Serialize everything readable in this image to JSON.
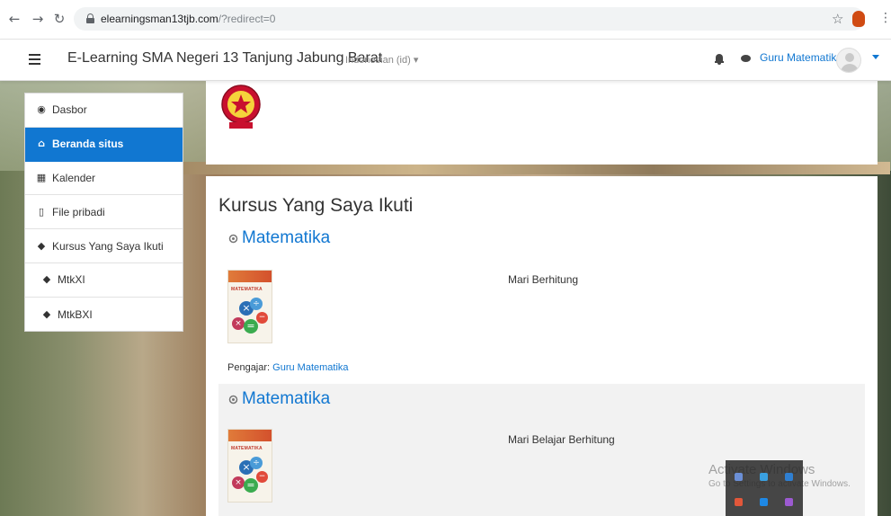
{
  "browser": {
    "back_icon": "arrow-left",
    "forward_icon": "arrow-right",
    "reload_icon": "reload",
    "url_host": "elearningsman13tjb.com",
    "url_path": "/?redirect=0"
  },
  "navbar": {
    "site_name": "E-Learning SMA Negeri 13 Tanjung Jabung Barat",
    "language": "Indonesian (id) ▾",
    "user_name": "Guru Matematika"
  },
  "drawer": {
    "items": [
      {
        "label": "Dasbor",
        "icon": "dashboard-icon"
      },
      {
        "label": "Beranda situs",
        "icon": "home-icon"
      },
      {
        "label": "Kalender",
        "icon": "calendar-icon"
      },
      {
        "label": "File pribadi",
        "icon": "file-icon"
      },
      {
        "label": "Kursus Yang Saya Ikuti",
        "icon": "graduation-cap-icon"
      },
      {
        "label": "MtkXI",
        "icon": "graduation-cap-icon"
      },
      {
        "label": "MtkBXI",
        "icon": "graduation-cap-icon"
      }
    ]
  },
  "main": {
    "title": "Kursus Yang Saya Ikuti",
    "courses": [
      {
        "name": "Matematika",
        "summary": "Mari Berhitung",
        "image_label": "MATEMATIKA",
        "teacher_label": "Pengajar:",
        "teacher_name": "Guru Matematika"
      },
      {
        "name": "Matematika",
        "summary": "Mari Belajar Berhitung",
        "image_label": "MATEMATIKA"
      }
    ]
  },
  "windows_overlay": {
    "title": "Activate Windows",
    "subtitle": "Go to Settings to activate Windows."
  },
  "colors": {
    "accent": "#1177d1",
    "active_drawer_bg": "#1177d1"
  }
}
